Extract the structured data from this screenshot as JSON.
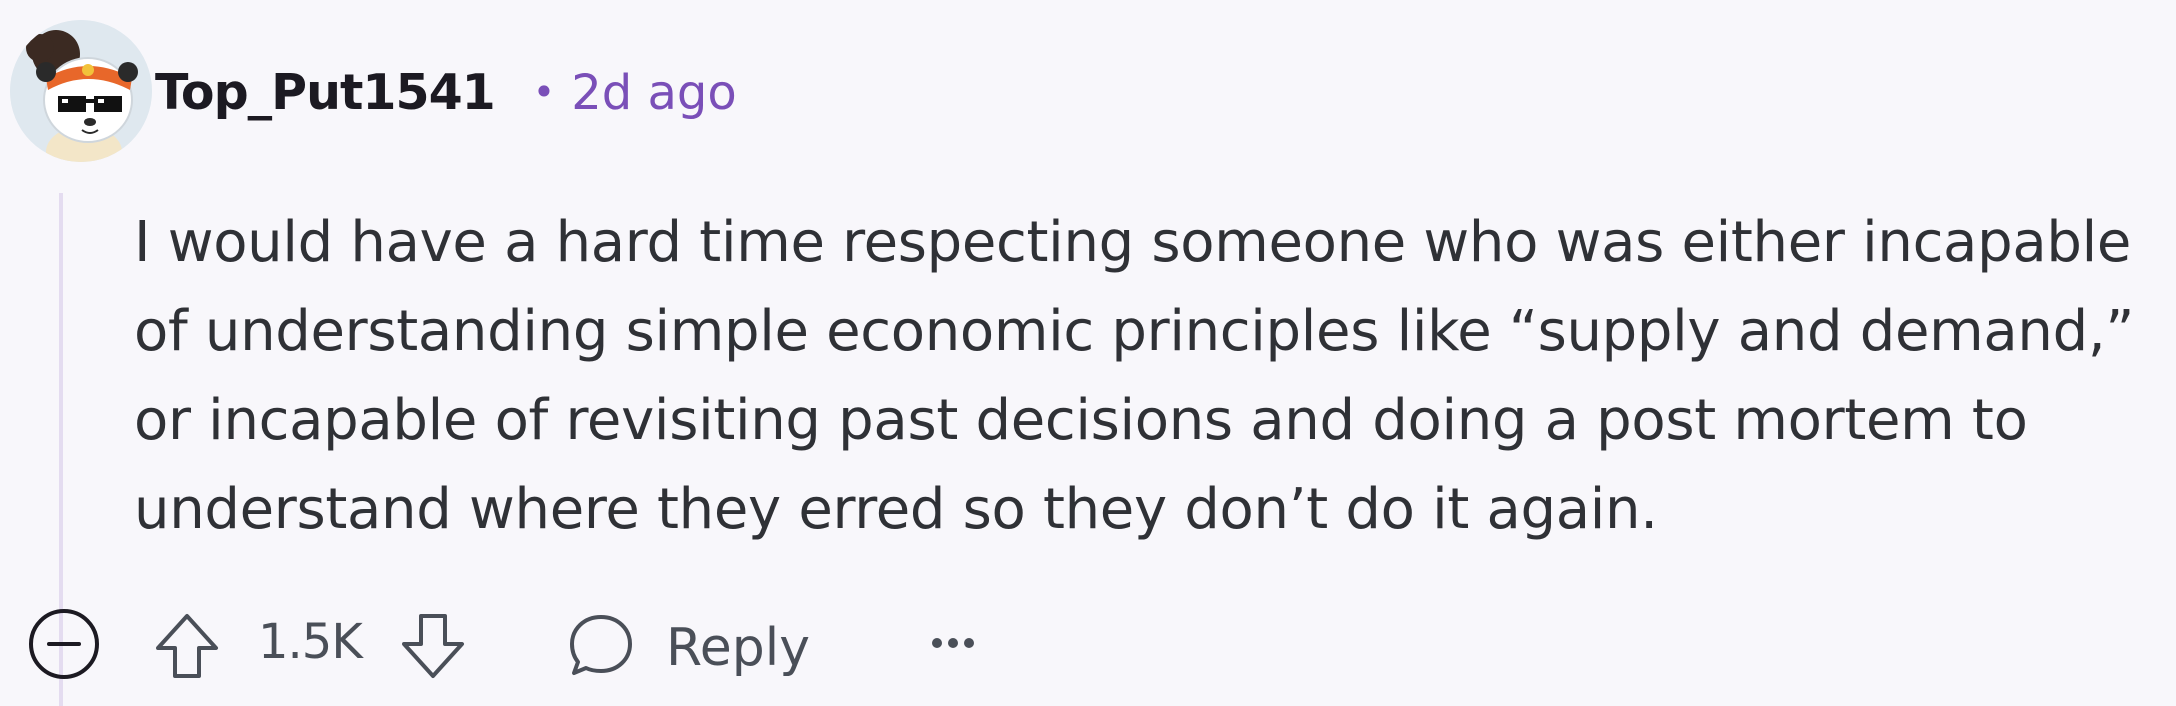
{
  "comment": {
    "username": "Top_Put1541",
    "separator": "•",
    "timestamp": "2d ago",
    "body": "I would have a hard time respecting someone who was either incapable of understanding simple economic principles like “supply and demand,” or incapable of revisiting past decisions and doing a post mortem to understand where they erred so they don’t do it again.",
    "score": "1.5K",
    "reply_label": "Reply"
  },
  "icons": {
    "avatar": "avatar-panda-with-sunglasses",
    "collapse": "collapse-minus-icon",
    "upvote": "arrow-up-icon",
    "downvote": "arrow-down-icon",
    "reply": "speech-bubble-icon",
    "more": "more-dots-icon"
  },
  "colors": {
    "background": "#f8f7fb",
    "timestamp": "#7a4fb8",
    "thread_line": "#e4dcf0",
    "text": "#2f3136"
  }
}
